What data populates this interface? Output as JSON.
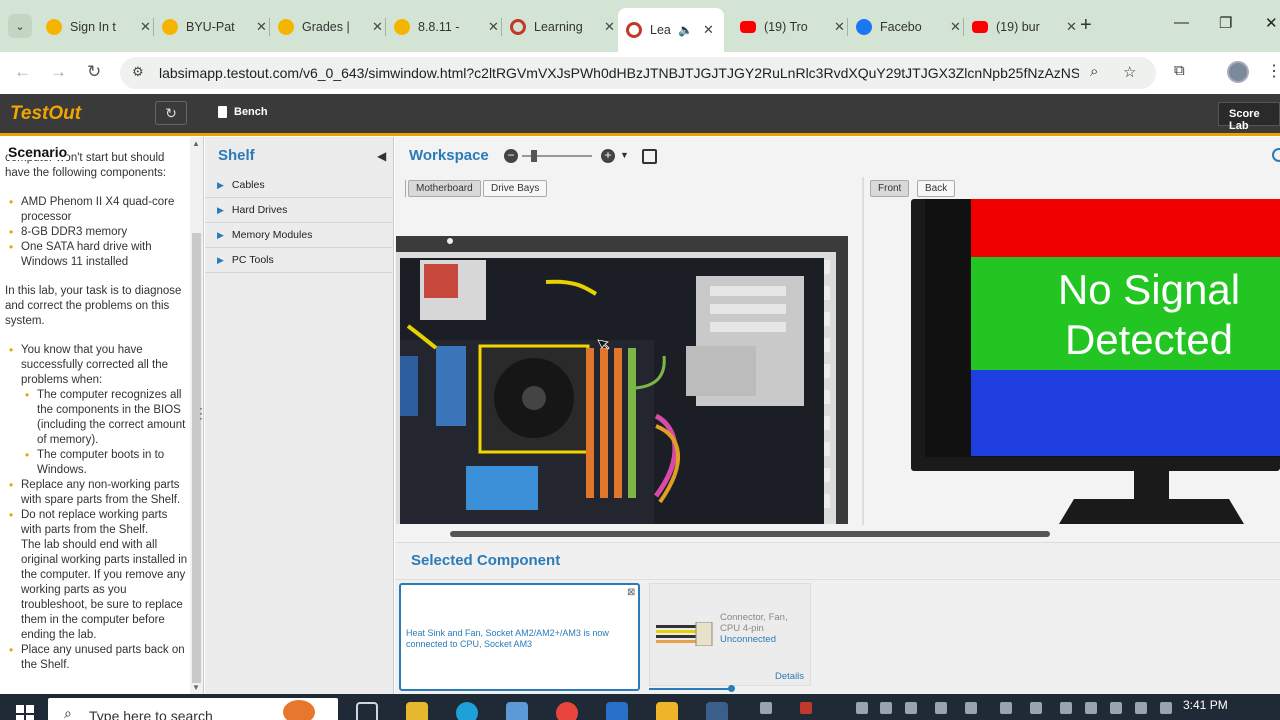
{
  "browser": {
    "tabs": [
      {
        "title": "Sign In t",
        "color": "#f5b400"
      },
      {
        "title": "BYU-Pat",
        "color": "#f5b400"
      },
      {
        "title": "Grades |",
        "color": "#f5b400"
      },
      {
        "title": "8.8.11 -",
        "color": "#f5b400"
      },
      {
        "title": "Learning",
        "color": "#c0392b"
      },
      {
        "title": "Lea",
        "color": "#c0392b"
      },
      {
        "title": "(19) Tro",
        "color": "#ff0000"
      },
      {
        "title": "Facebo",
        "color": "#1877f2"
      },
      {
        "title": "(19) bur",
        "color": "#ff0000"
      }
    ],
    "url": "labsimapp.testout.com/v6_0_643/simwindow.html?c2ltRGVmVXJsPWh0dHBzJTNBJTJGJTJGY2RuLnRlc3RvdXQuY29tJTJGX3ZlcnNpb25fNzAzNSUyR..."
  },
  "app": {
    "logo": "TestOut",
    "bench_label": "Bench",
    "score_label": "Score Lab"
  },
  "scenario": {
    "title": "Scenario",
    "intro": "computer won't start but should have the following components:",
    "components": [
      "AMD Phenom II X4 quad-core processor",
      "8-GB DDR3 memory",
      "One SATA hard drive with Windows 11 installed"
    ],
    "task": "In this lab, your task is to diagnose and correct the problems on this system.",
    "success_intro": "You know that you have successfully corrected all the problems when:",
    "success_items": [
      "The computer recognizes all the components in the BIOS (including the correct amount of memory).",
      "The computer boots in to Windows."
    ],
    "rule_replace": "Replace any non-working parts with spare parts from the Shelf.",
    "rule_keep": "Do not replace working parts with parts from the Shelf.",
    "rule_keep_detail": "The lab should end with all original working parts installed in the computer. If you remove any working parts as you troubleshoot, be sure to replace them in the computer before ending the lab.",
    "rule_unused": "Place any unused parts back on the Shelf."
  },
  "shelf": {
    "title": "Shelf",
    "items": [
      "Cables",
      "Hard Drives",
      "Memory Modules",
      "PC Tools"
    ]
  },
  "workspace": {
    "title": "Workspace",
    "left_tabs": [
      "Motherboard",
      "Drive Bays"
    ],
    "right_tabs": [
      "Front",
      "Back"
    ],
    "monitor_line1": "No Signal",
    "monitor_line2": "Detected"
  },
  "selected_component": {
    "title": "Selected Component",
    "message": "Heat Sink and Fan, Socket AM2/AM2+/AM3 is now connected to CPU, Socket AM3",
    "connector_name": "Connector, Fan, CPU 4-pin",
    "connector_status": "Unconnected",
    "details_label": "Details"
  },
  "taskbar": {
    "search_placeholder": "Type here to search",
    "clock": "3:41 PM"
  }
}
